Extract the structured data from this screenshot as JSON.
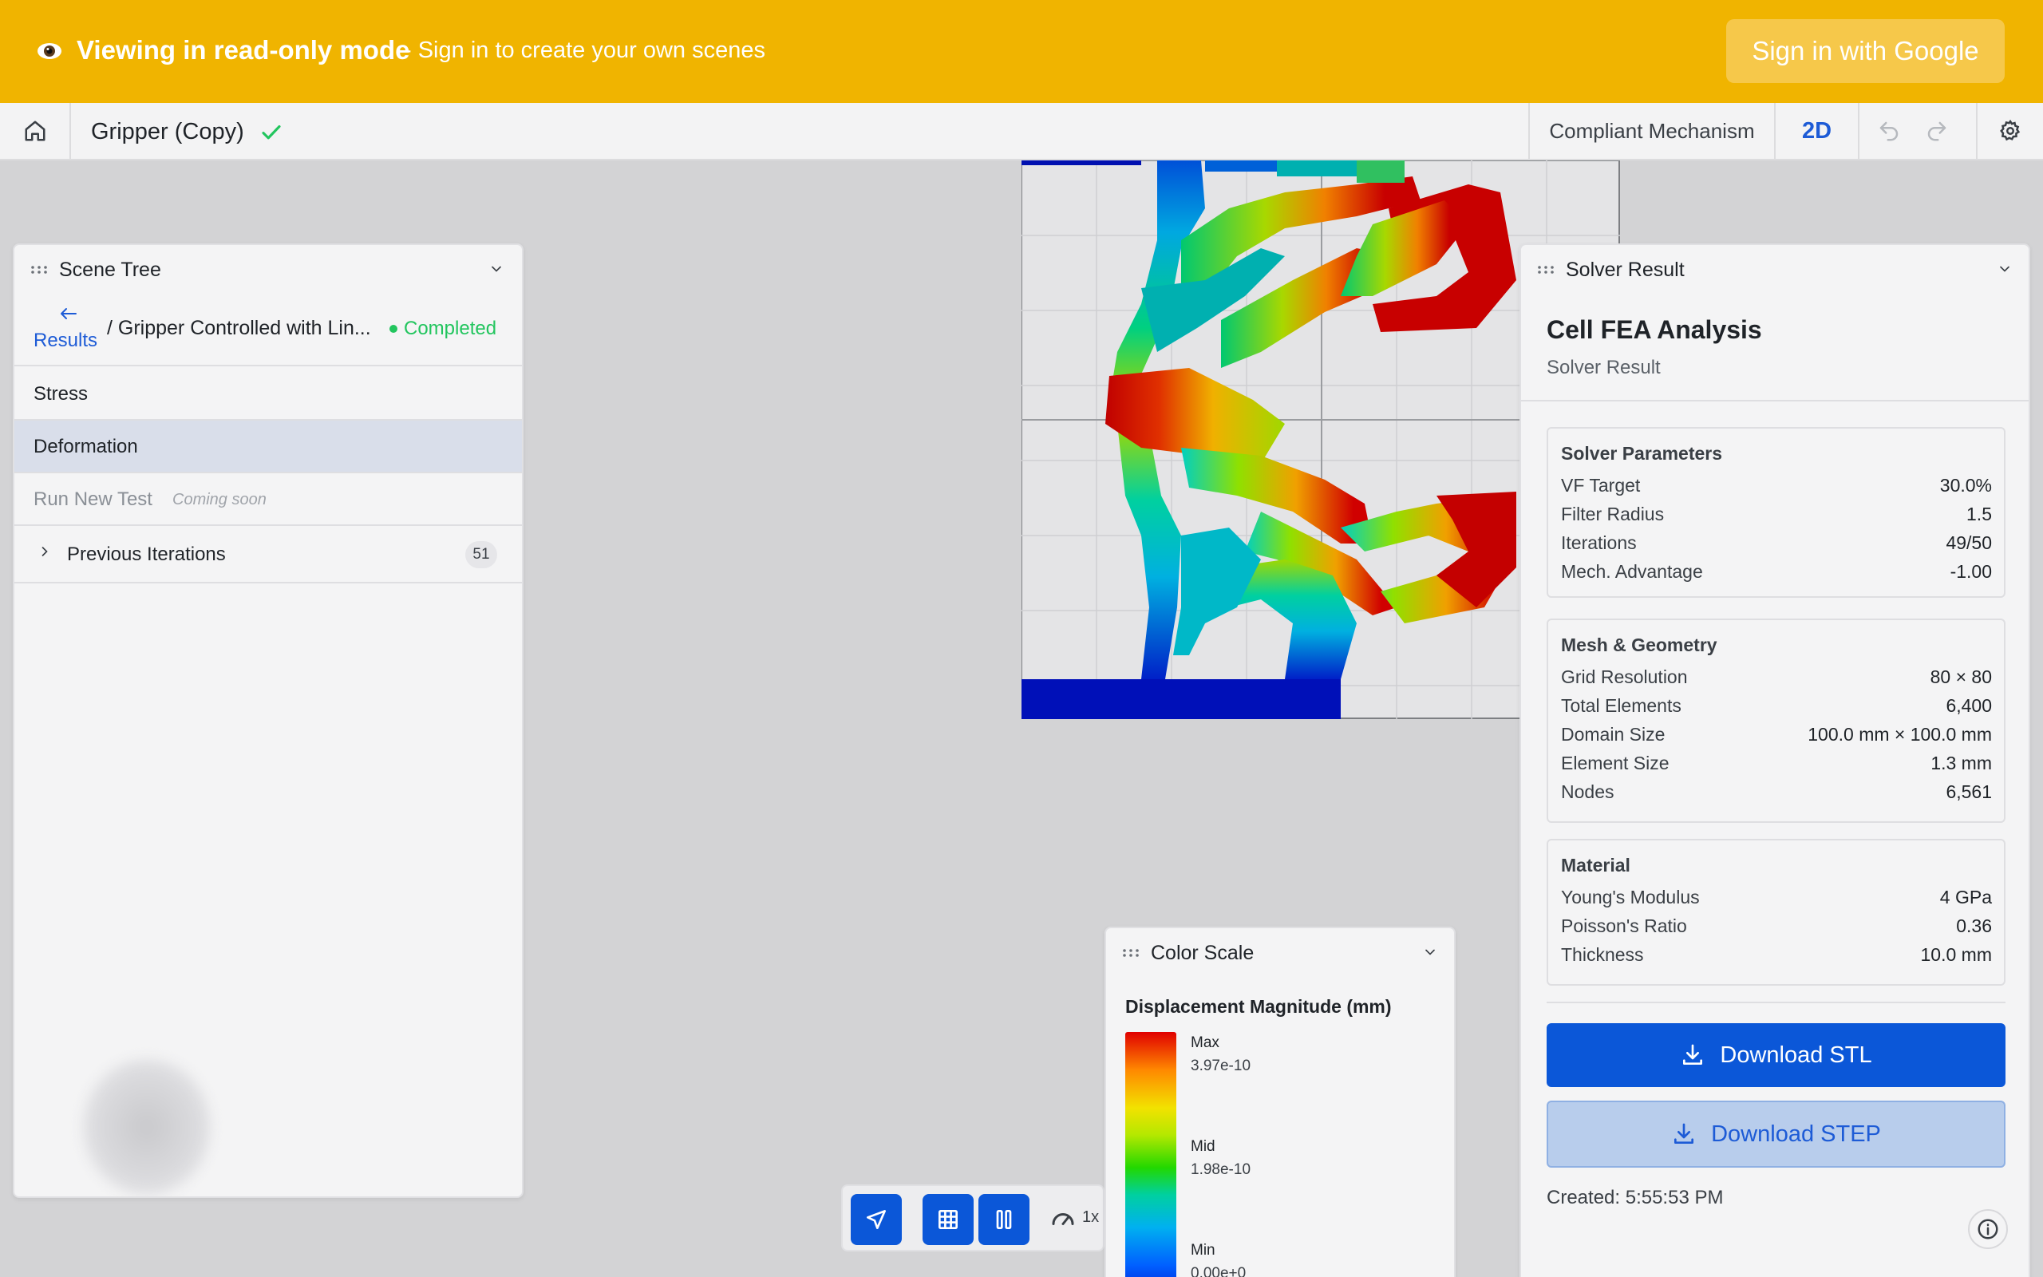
{
  "banner": {
    "mode_text": "Viewing in read-only mode",
    "hint_text": "- Sign in to create your own scenes",
    "signin_label": "Sign in with Google",
    "bg_color": "#f0b400"
  },
  "toolbar": {
    "home_icon": "home-icon",
    "scene_title": "Gripper (Copy)",
    "saved_icon": "check-icon",
    "mode_label": "Compliant Mechanism",
    "view_label": "2D",
    "undo_icon": "undo-icon",
    "redo_icon": "redo-icon",
    "settings_icon": "gear-icon"
  },
  "scene_tree": {
    "title": "Scene Tree",
    "back_label": "Results",
    "path_label": "/ Gripper Controlled with Lin...",
    "status": "Completed",
    "items": [
      {
        "label": "Stress"
      },
      {
        "label": "Deformation"
      },
      {
        "label": "Run New Test",
        "note": "Coming soon"
      },
      {
        "label": "Previous Iterations",
        "count": "51"
      }
    ]
  },
  "solver": {
    "panel_title": "Solver Result",
    "heading": "Cell FEA Analysis",
    "subheading": "Solver Result",
    "params": {
      "title": "Solver Parameters",
      "rows": [
        {
          "k": "VF Target",
          "v": "30.0%"
        },
        {
          "k": "Filter Radius",
          "v": "1.5"
        },
        {
          "k": "Iterations",
          "v": "49/50"
        },
        {
          "k": "Mech. Advantage",
          "v": "-1.00"
        }
      ]
    },
    "mesh": {
      "title": "Mesh & Geometry",
      "rows": [
        {
          "k": "Grid Resolution",
          "v": "80 × 80"
        },
        {
          "k": "Total Elements",
          "v": "6,400"
        },
        {
          "k": "Domain Size",
          "v": "100.0 mm × 100.0 mm"
        },
        {
          "k": "Element Size",
          "v": "1.3 mm"
        },
        {
          "k": "Nodes",
          "v": "6,561"
        }
      ]
    },
    "material": {
      "title": "Material",
      "rows": [
        {
          "k": "Young's Modulus",
          "v": "4 GPa"
        },
        {
          "k": "Poisson's Ratio",
          "v": "0.36"
        },
        {
          "k": "Thickness",
          "v": "10.0 mm"
        }
      ]
    },
    "download_stl": "Download STL",
    "download_step": "Download STEP",
    "created": "Created: 5:55:53 PM"
  },
  "color_scale": {
    "panel_title": "Color Scale",
    "title": "Displacement Magnitude (mm)",
    "max_label": "Max",
    "max_value": "3.97e-10",
    "mid_label": "Mid",
    "mid_value": "1.98e-10",
    "min_label": "Min",
    "min_value": "0.00e+0"
  },
  "bottom_toolbar": {
    "select_icon": "cursor-icon",
    "grid_icon": "grid-icon",
    "pause_icon": "pause-icon",
    "speed_icon": "speedometer-icon",
    "speed_label": "1x"
  }
}
